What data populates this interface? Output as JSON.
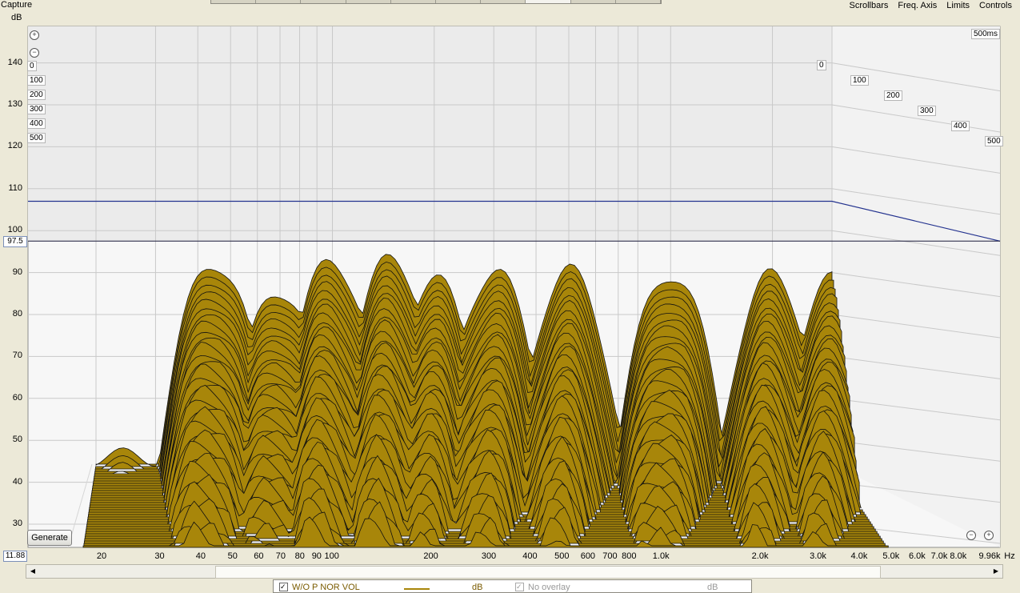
{
  "header": {
    "capture_label": "Capture",
    "y_unit": "dB",
    "menu": [
      "Scrollbars",
      "Freq. Axis",
      "Limits",
      "Controls"
    ]
  },
  "chart_data": {
    "type": "area",
    "title": "",
    "xlabel": "Hz",
    "ylabel": "dB",
    "x_scale": "log",
    "ylim": [
      27,
      148
    ],
    "xlim": [
      15,
      9960
    ],
    "y_ticks": [
      30,
      40,
      50,
      60,
      70,
      80,
      90,
      100,
      110,
      120,
      130,
      140
    ],
    "x_ticks": [
      {
        "v": 20,
        "label": "20"
      },
      {
        "v": 30,
        "label": "30"
      },
      {
        "v": 40,
        "label": "40"
      },
      {
        "v": 50,
        "label": "50"
      },
      {
        "v": 60,
        "label": "60"
      },
      {
        "v": 70,
        "label": "70"
      },
      {
        "v": 80,
        "label": "80"
      },
      {
        "v": 90,
        "label": "90"
      },
      {
        "v": 100,
        "label": "100"
      },
      {
        "v": 200,
        "label": "200"
      },
      {
        "v": 300,
        "label": "300"
      },
      {
        "v": 400,
        "label": "400"
      },
      {
        "v": 500,
        "label": "500"
      },
      {
        "v": 600,
        "label": "600"
      },
      {
        "v": 700,
        "label": "700"
      },
      {
        "v": 800,
        "label": "800"
      },
      {
        "v": 1000,
        "label": "1.0k"
      },
      {
        "v": 2000,
        "label": "2.0k"
      },
      {
        "v": 3000,
        "label": "3.0k"
      },
      {
        "v": 4000,
        "label": "4.0k"
      },
      {
        "v": 5000,
        "label": "5.0k"
      },
      {
        "v": 6000,
        "label": "6.0k"
      },
      {
        "v": 7000,
        "label": "7.0k"
      },
      {
        "v": 8000,
        "label": "8.0k"
      },
      {
        "v": 9960,
        "label": "9.96k"
      }
    ],
    "time_axis_label": "500ms",
    "time_ticks_ms": [
      "0",
      "100",
      "200",
      "300",
      "400",
      "500"
    ],
    "left_time_labels": [
      "0",
      "100",
      "200",
      "300",
      "400",
      "500"
    ],
    "upper_limit_db": 107,
    "marker_db": 97.5,
    "marker_label": "97.5",
    "y_min_label": "11.88",
    "fill_color": "#a8860a",
    "line_color": "#111111",
    "limit_line_color": "#24338f",
    "peaks": [
      {
        "freq": 45,
        "db": 92.5
      },
      {
        "freq": 70,
        "db": 86
      },
      {
        "freq": 100,
        "db": 92.5
      },
      {
        "freq": 150,
        "db": 93
      },
      {
        "freq": 200,
        "db": 88
      },
      {
        "freq": 300,
        "db": 90
      },
      {
        "freq": 500,
        "db": 90
      },
      {
        "freq": 1000,
        "db": 90
      },
      {
        "freq": 2000,
        "db": 89
      },
      {
        "freq": 3000,
        "db": 88
      }
    ],
    "grid": true
  },
  "controls": {
    "generate_label": "Generate"
  },
  "legend": {
    "series_name": "W/O P NOR VOL",
    "series_unit": "dB",
    "overlay_label": "No overlay",
    "overlay_unit": "dB"
  }
}
